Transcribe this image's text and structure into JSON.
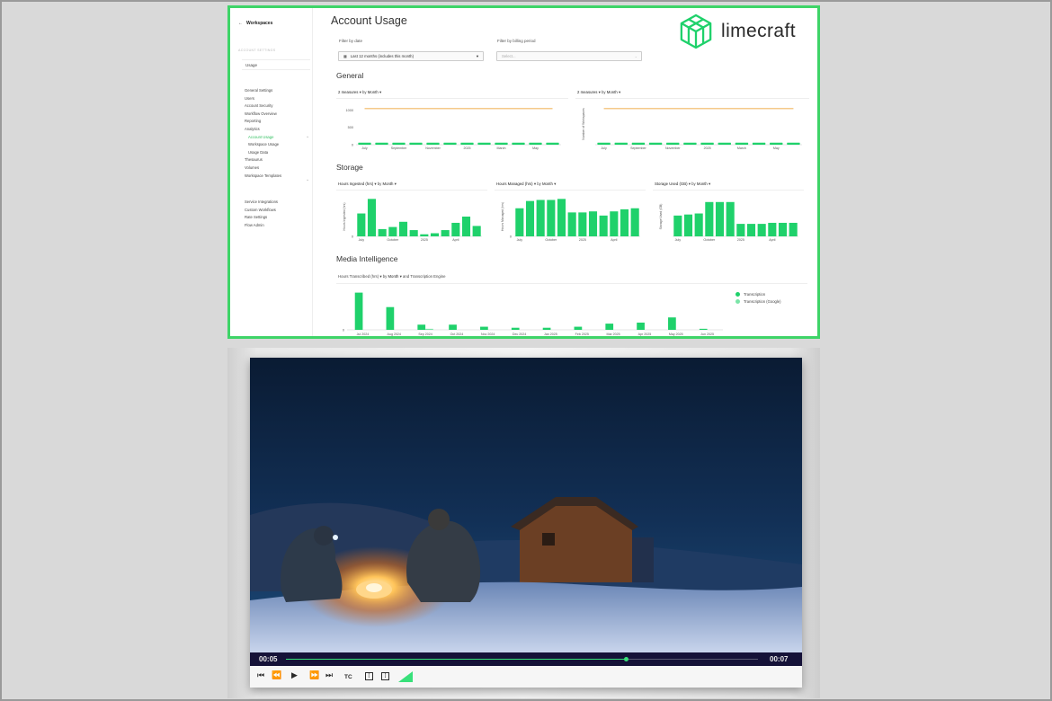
{
  "sidebar": {
    "back_label": "Workspaces",
    "section_label": "ACCOUNT SETTINGS",
    "usage_label": "Usage",
    "items": [
      {
        "label": "General Settings",
        "sub": false,
        "active": false
      },
      {
        "label": "Users",
        "sub": false,
        "active": false
      },
      {
        "label": "Account Security",
        "sub": false,
        "active": false
      },
      {
        "label": "Workflow Overview",
        "sub": false,
        "active": false
      },
      {
        "label": "Reporting",
        "sub": false,
        "active": false
      },
      {
        "label": "Analytics",
        "sub": false,
        "active": false
      },
      {
        "label": "Account Usage",
        "sub": true,
        "active": true
      },
      {
        "label": "Workspace Usage",
        "sub": true,
        "active": false
      },
      {
        "label": "Usage Data",
        "sub": true,
        "active": false
      },
      {
        "label": "Thesaurus",
        "sub": false,
        "active": false
      },
      {
        "label": "Volumes",
        "sub": false,
        "active": false
      },
      {
        "label": "Workspace Templates",
        "sub": false,
        "active": false
      }
    ],
    "items2": [
      {
        "label": "Service Integrations"
      },
      {
        "label": "Custom Workflows"
      },
      {
        "label": "Rate Settings"
      },
      {
        "label": "Flow Admin"
      }
    ]
  },
  "header": {
    "title": "Account Usage",
    "logo_text": "limecraft"
  },
  "filters": {
    "date_label": "Filter by date",
    "date_value": "Last 12 months (includes this month)",
    "billing_label": "Filter by billing period",
    "billing_placeholder": "Select..."
  },
  "sections": {
    "general": "General",
    "storage": "Storage",
    "media": "Media Intelligence"
  },
  "measures": {
    "general_1": {
      "measure": "2 measures",
      "by": "by",
      "unit": "Month"
    },
    "general_2": {
      "measure": "2 measures",
      "by": "by",
      "unit": "Month"
    },
    "storage_1": {
      "measure": "Hours Ingested (hrs)",
      "by": "by",
      "unit": "Month"
    },
    "storage_2": {
      "measure": "Hours Managed (hrs)",
      "by": "by",
      "unit": "Month"
    },
    "storage_3": {
      "measure": "Storage Used (GB)",
      "by": "by",
      "unit": "Month"
    },
    "media": {
      "measure": "Hours Transcribed (hrs)",
      "by": "by",
      "unit": "Month",
      "and": "and",
      "extra": "Transcription Engine"
    }
  },
  "chart_data": [
    {
      "type": "bar",
      "ylabel": "",
      "yticks": [
        "1000",
        "500",
        "0"
      ],
      "categories": [
        "Jul",
        "Aug",
        "Sep",
        "Oct",
        "Nov",
        "Dec",
        "Jan",
        "Feb",
        "Mar",
        "Apr",
        "May",
        "Jun"
      ],
      "xtick_labels": [
        "July",
        "September",
        "November",
        "2025",
        "March",
        "May"
      ],
      "series": [
        {
          "values": [
            1050,
            1050,
            1050,
            1050,
            1050,
            1050,
            1050,
            1050,
            1050,
            1050,
            1050,
            1050
          ]
        },
        {
          "values": [
            30,
            30,
            30,
            30,
            30,
            30,
            30,
            30,
            30,
            30,
            30,
            30
          ]
        }
      ],
      "colors": [
        "#f5c98a",
        "#1fd16b"
      ],
      "ylim": [
        0,
        1200
      ]
    },
    {
      "type": "bar",
      "ylabel": "Number of Workspaces",
      "categories": [
        "Jul",
        "Aug",
        "Sep",
        "Oct",
        "Nov",
        "Dec",
        "Jan",
        "Feb",
        "Mar",
        "Apr",
        "May",
        "Jun"
      ],
      "xtick_labels": [
        "July",
        "September",
        "November",
        "2025",
        "March",
        "May"
      ],
      "series": [
        {
          "values": [
            105,
            105,
            105,
            105,
            105,
            105,
            105,
            105,
            105,
            105,
            105,
            105
          ]
        },
        {
          "values": [
            6,
            6,
            6,
            6,
            6,
            6,
            6,
            6,
            6,
            6,
            6,
            6
          ]
        }
      ],
      "colors": [
        "#f5c98a",
        "#1fd16b"
      ],
      "ylim": [
        0,
        120
      ]
    },
    {
      "type": "bar",
      "ylabel": "Hours Ingested (hrs)",
      "yticks": [
        "0"
      ],
      "categories": [
        "Jul",
        "Aug",
        "Sep",
        "Oct",
        "Nov",
        "Dec",
        "Jan",
        "Feb",
        "Mar",
        "Apr",
        "May",
        "Jun"
      ],
      "xtick_labels": [
        "July",
        "October",
        "2025",
        "April"
      ],
      "values": [
        22,
        36,
        7,
        9,
        14,
        6,
        2,
        3,
        6,
        13,
        19,
        10
      ],
      "ylim": [
        0,
        38
      ]
    },
    {
      "type": "bar",
      "ylabel": "Hours Managed (hrs)",
      "yticks": [
        "0"
      ],
      "categories": [
        "Jul",
        "Aug",
        "Sep",
        "Oct",
        "Nov",
        "Dec",
        "Jan",
        "Feb",
        "Mar",
        "Apr",
        "May",
        "Jun"
      ],
      "xtick_labels": [
        "July",
        "October",
        "2025",
        "April"
      ],
      "values": [
        27,
        34,
        35,
        35,
        36,
        23,
        23,
        24,
        20,
        24,
        26,
        27
      ],
      "ylim": [
        0,
        38
      ]
    },
    {
      "type": "bar",
      "ylabel": "Storage Used (GB)",
      "categories": [
        "Jul",
        "Aug",
        "Sep",
        "Oct",
        "Nov",
        "Dec",
        "Jan",
        "Feb",
        "Mar",
        "Apr",
        "May",
        "Jun"
      ],
      "xtick_labels": [
        "July",
        "October",
        "2025",
        "April"
      ],
      "values": [
        20,
        21,
        22,
        33,
        33,
        33,
        12,
        12,
        12,
        13,
        13,
        13
      ],
      "ylim": [
        0,
        38
      ]
    },
    {
      "type": "bar",
      "ylabel": "",
      "yticks": [
        "0"
      ],
      "categories": [
        "Jul 2024",
        "Aug 2024",
        "Sep 2024",
        "Oct 2024",
        "Nov 2024",
        "Dec 2024",
        "Jan 2025",
        "Feb 2025",
        "Mar 2025",
        "Apr 2025",
        "May 2025",
        "Jun 2025"
      ],
      "series": [
        {
          "name": "Transcription",
          "values": [
            36,
            22,
            5,
            5,
            3,
            2,
            2,
            3,
            6,
            7,
            12,
            1
          ]
        },
        {
          "name": "Transcription (Google)",
          "values": [
            0,
            0,
            1,
            0,
            0,
            0,
            0,
            0,
            0,
            0,
            0,
            0
          ]
        }
      ],
      "colors": [
        "#1fd16b",
        "#7be5a8"
      ],
      "ylim": [
        0,
        40
      ]
    }
  ],
  "player": {
    "current_time": "00:05",
    "total_time": "00:07",
    "progress": 0.72,
    "tc_label": "TC",
    "accent": "#38e07a"
  },
  "colors": {
    "accent": "#1fd16b",
    "frame": "#3fd468",
    "target": "#f5c98a",
    "player_bar": "#151238"
  }
}
